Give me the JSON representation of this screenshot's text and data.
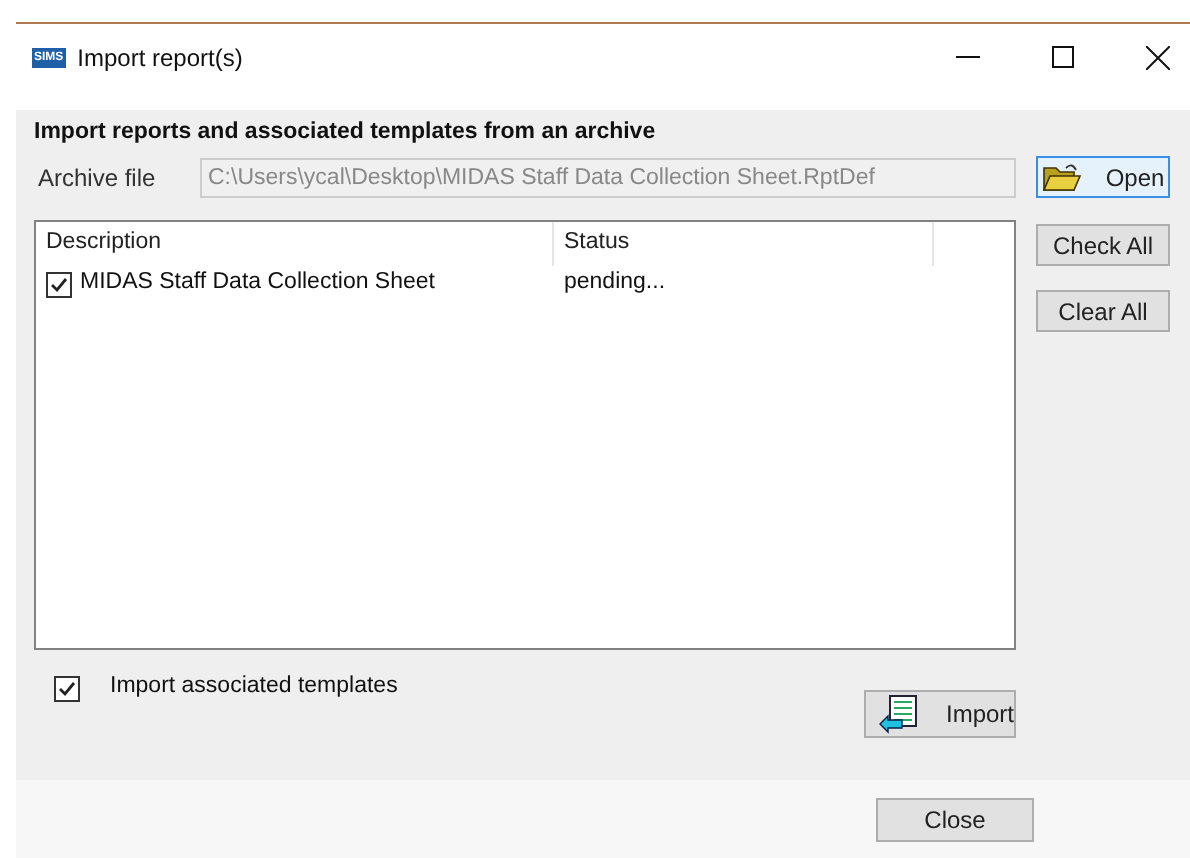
{
  "window": {
    "title": "Import report(s)",
    "logo": "SIMS"
  },
  "heading": "Import reports and associated templates from an archive",
  "archive": {
    "label": "Archive file",
    "value": "C:\\Users\\ycal\\Desktop\\MIDAS Staff Data Collection Sheet.RptDef"
  },
  "side_buttons": [
    {
      "label": "Open",
      "kind": "open"
    },
    {
      "label": "Check All",
      "kind": "plain"
    },
    {
      "label": "Clear All",
      "kind": "plain"
    }
  ],
  "table": {
    "columns": [
      "Description",
      "Status"
    ],
    "rows": [
      {
        "description": "MIDAS Staff Data Collection Sheet",
        "status": "pending...",
        "checked": true
      }
    ]
  },
  "import_templates": {
    "label": "Import associated templates",
    "checked": true
  },
  "import_button": "Import",
  "close_button": "Close"
}
